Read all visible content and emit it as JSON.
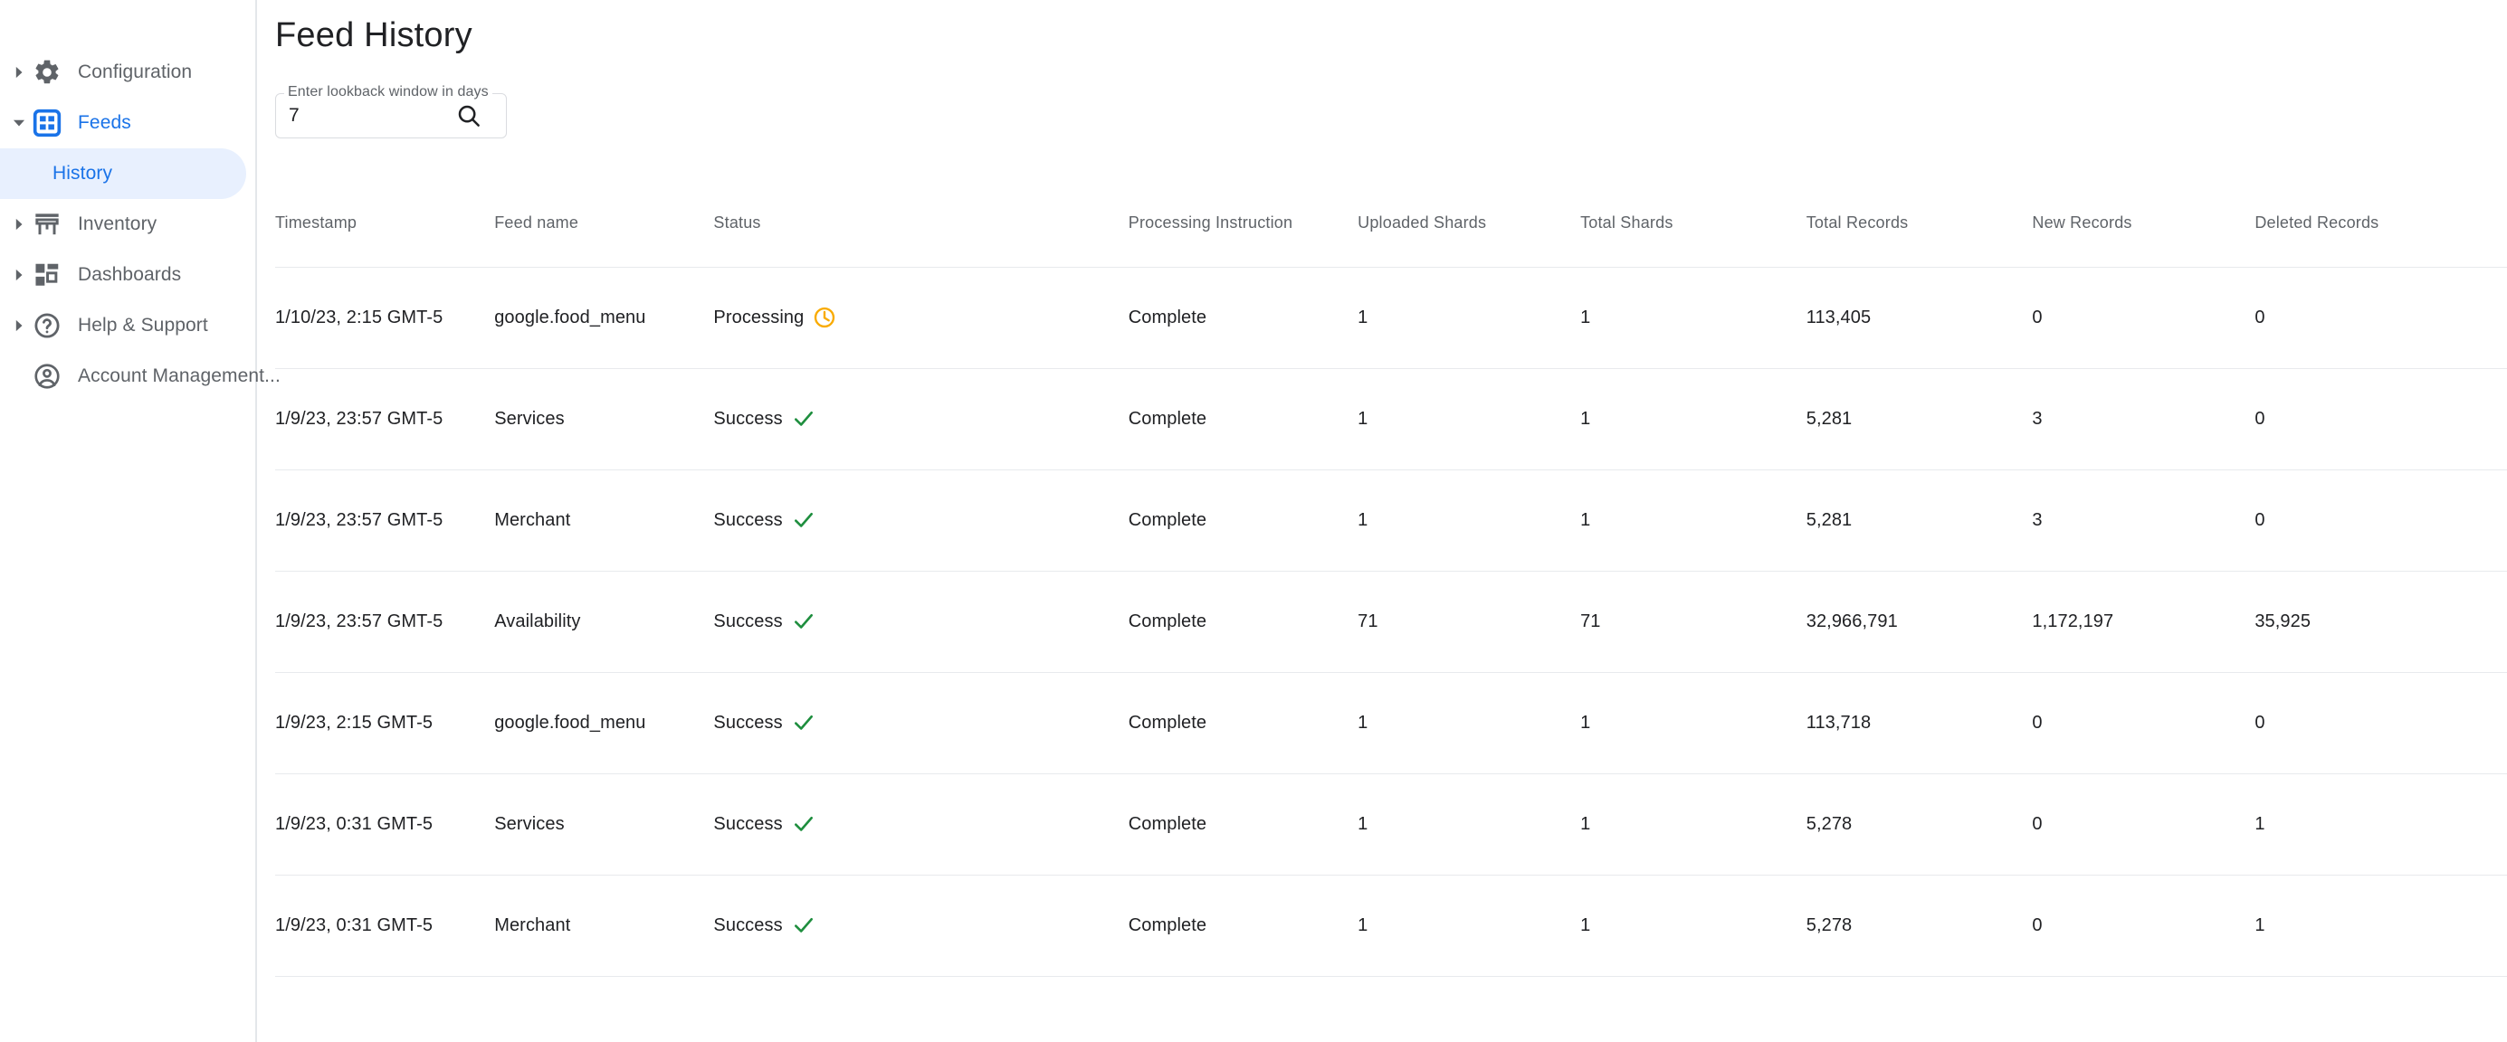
{
  "sidebar": {
    "items": [
      {
        "label": "Configuration",
        "icon": "gear-icon",
        "expandable": true,
        "expanded": false,
        "selected": false,
        "child": false
      },
      {
        "label": "Feeds",
        "icon": "feeds-grid-icon",
        "expandable": true,
        "expanded": true,
        "selected": true,
        "child": false
      },
      {
        "label": "History",
        "icon": "",
        "expandable": false,
        "expanded": false,
        "selected": true,
        "child": true
      },
      {
        "label": "Inventory",
        "icon": "storefront-icon",
        "expandable": true,
        "expanded": false,
        "selected": false,
        "child": false
      },
      {
        "label": "Dashboards",
        "icon": "dashboard-icon",
        "expandable": true,
        "expanded": false,
        "selected": false,
        "child": false
      },
      {
        "label": "Help & Support",
        "icon": "help-circle-icon",
        "expandable": true,
        "expanded": false,
        "selected": false,
        "child": false
      },
      {
        "label": "Account Management...",
        "icon": "account-circle-icon",
        "expandable": false,
        "expanded": false,
        "selected": false,
        "child": false
      }
    ]
  },
  "page": {
    "title": "Feed History"
  },
  "lookback": {
    "label": "Enter lookback window in days",
    "value": "7",
    "placeholder": "",
    "search_icon": "search-icon"
  },
  "table": {
    "columns": [
      "Timestamp",
      "Feed name",
      "Status",
      "Processing Instruction",
      "Uploaded Shards",
      "Total Shards",
      "Total Records",
      "New Records",
      "Deleted Records"
    ],
    "rows": [
      {
        "timestamp": "1/10/23, 2:15 GMT-5",
        "feed_name": "google.food_menu",
        "status": "Processing",
        "status_icon": "clock-icon",
        "processing_instruction": "Complete",
        "uploaded_shards": "1",
        "total_shards": "1",
        "total_records": "113,405",
        "new_records": "0",
        "new_records_color": "plain",
        "deleted_records": "0",
        "deleted_records_color": "plain"
      },
      {
        "timestamp": "1/9/23, 23:57 GMT-5",
        "feed_name": "Services",
        "status": "Success",
        "status_icon": "check-icon",
        "processing_instruction": "Complete",
        "uploaded_shards": "1",
        "total_shards": "1",
        "total_records": "5,281",
        "new_records": "3",
        "new_records_color": "green",
        "deleted_records": "0",
        "deleted_records_color": "plain"
      },
      {
        "timestamp": "1/9/23, 23:57 GMT-5",
        "feed_name": "Merchant",
        "status": "Success",
        "status_icon": "check-icon",
        "processing_instruction": "Complete",
        "uploaded_shards": "1",
        "total_shards": "1",
        "total_records": "5,281",
        "new_records": "3",
        "new_records_color": "green",
        "deleted_records": "0",
        "deleted_records_color": "plain"
      },
      {
        "timestamp": "1/9/23, 23:57 GMT-5",
        "feed_name": "Availability",
        "status": "Success",
        "status_icon": "check-icon",
        "processing_instruction": "Complete",
        "uploaded_shards": "71",
        "total_shards": "71",
        "total_records": "32,966,791",
        "new_records": "1,172,197",
        "new_records_color": "green",
        "deleted_records": "35,925",
        "deleted_records_color": "red"
      },
      {
        "timestamp": "1/9/23, 2:15 GMT-5",
        "feed_name": "google.food_menu",
        "status": "Success",
        "status_icon": "check-icon",
        "processing_instruction": "Complete",
        "uploaded_shards": "1",
        "total_shards": "1",
        "total_records": "113,718",
        "new_records": "0",
        "new_records_color": "plain",
        "deleted_records": "0",
        "deleted_records_color": "plain"
      },
      {
        "timestamp": "1/9/23, 0:31 GMT-5",
        "feed_name": "Services",
        "status": "Success",
        "status_icon": "check-icon",
        "processing_instruction": "Complete",
        "uploaded_shards": "1",
        "total_shards": "1",
        "total_records": "5,278",
        "new_records": "0",
        "new_records_color": "plain",
        "deleted_records": "1",
        "deleted_records_color": "red"
      },
      {
        "timestamp": "1/9/23, 0:31 GMT-5",
        "feed_name": "Merchant",
        "status": "Success",
        "status_icon": "check-icon",
        "processing_instruction": "Complete",
        "uploaded_shards": "1",
        "total_shards": "1",
        "total_records": "5,278",
        "new_records": "0",
        "new_records_color": "plain",
        "deleted_records": "1",
        "deleted_records_color": "red"
      }
    ]
  },
  "colors": {
    "accent_blue": "#1a73e8",
    "pill_bg": "#e8f0fe",
    "success_green": "#1e8e3e",
    "value_green": "#188038",
    "value_red": "#ea4335",
    "processing_amber": "#f9ab00",
    "text_primary": "#202124",
    "text_secondary": "#5f6368"
  }
}
